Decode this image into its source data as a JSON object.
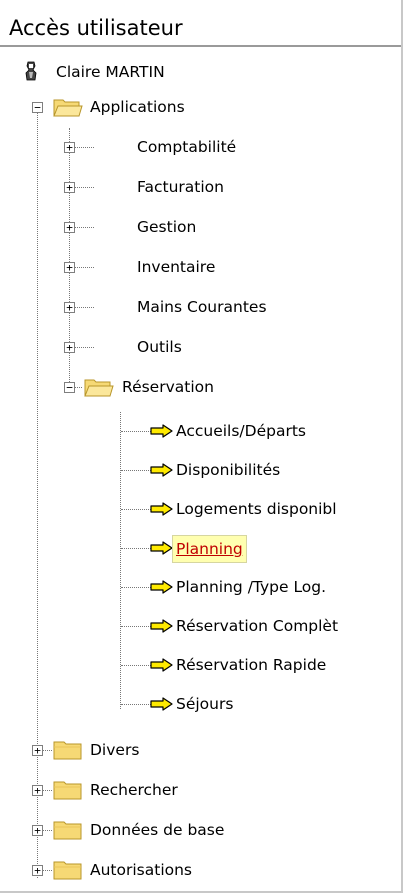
{
  "panel": {
    "title": "Accès utilisateur"
  },
  "user": {
    "name": "Claire MARTIN"
  },
  "tree": {
    "applications": {
      "label": "Applications",
      "children": [
        "Comptabilité",
        "Facturation",
        "Gestion",
        "Inventaire",
        "Mains Courantes",
        "Outils"
      ],
      "reservation": {
        "label": "Réservation",
        "items": [
          "Accueils/Départs",
          "Disponibilités",
          "Logements disponibl",
          "Planning",
          "Planning /Type Log.",
          "Réservation Complèt",
          "Réservation Rapide",
          "Séjours"
        ],
        "selected_index": 3
      }
    },
    "roots": [
      "Divers",
      "Rechercher",
      "Données de base",
      "Autorisations"
    ]
  },
  "colors": {
    "folder_fill": "#f6d975",
    "folder_edge": "#b8962a",
    "arrow": "#ffea00",
    "selection_bg": "#ffffb0",
    "selection_text": "#c00000"
  },
  "icons": {
    "expander_plus": "+",
    "expander_minus": "−"
  }
}
